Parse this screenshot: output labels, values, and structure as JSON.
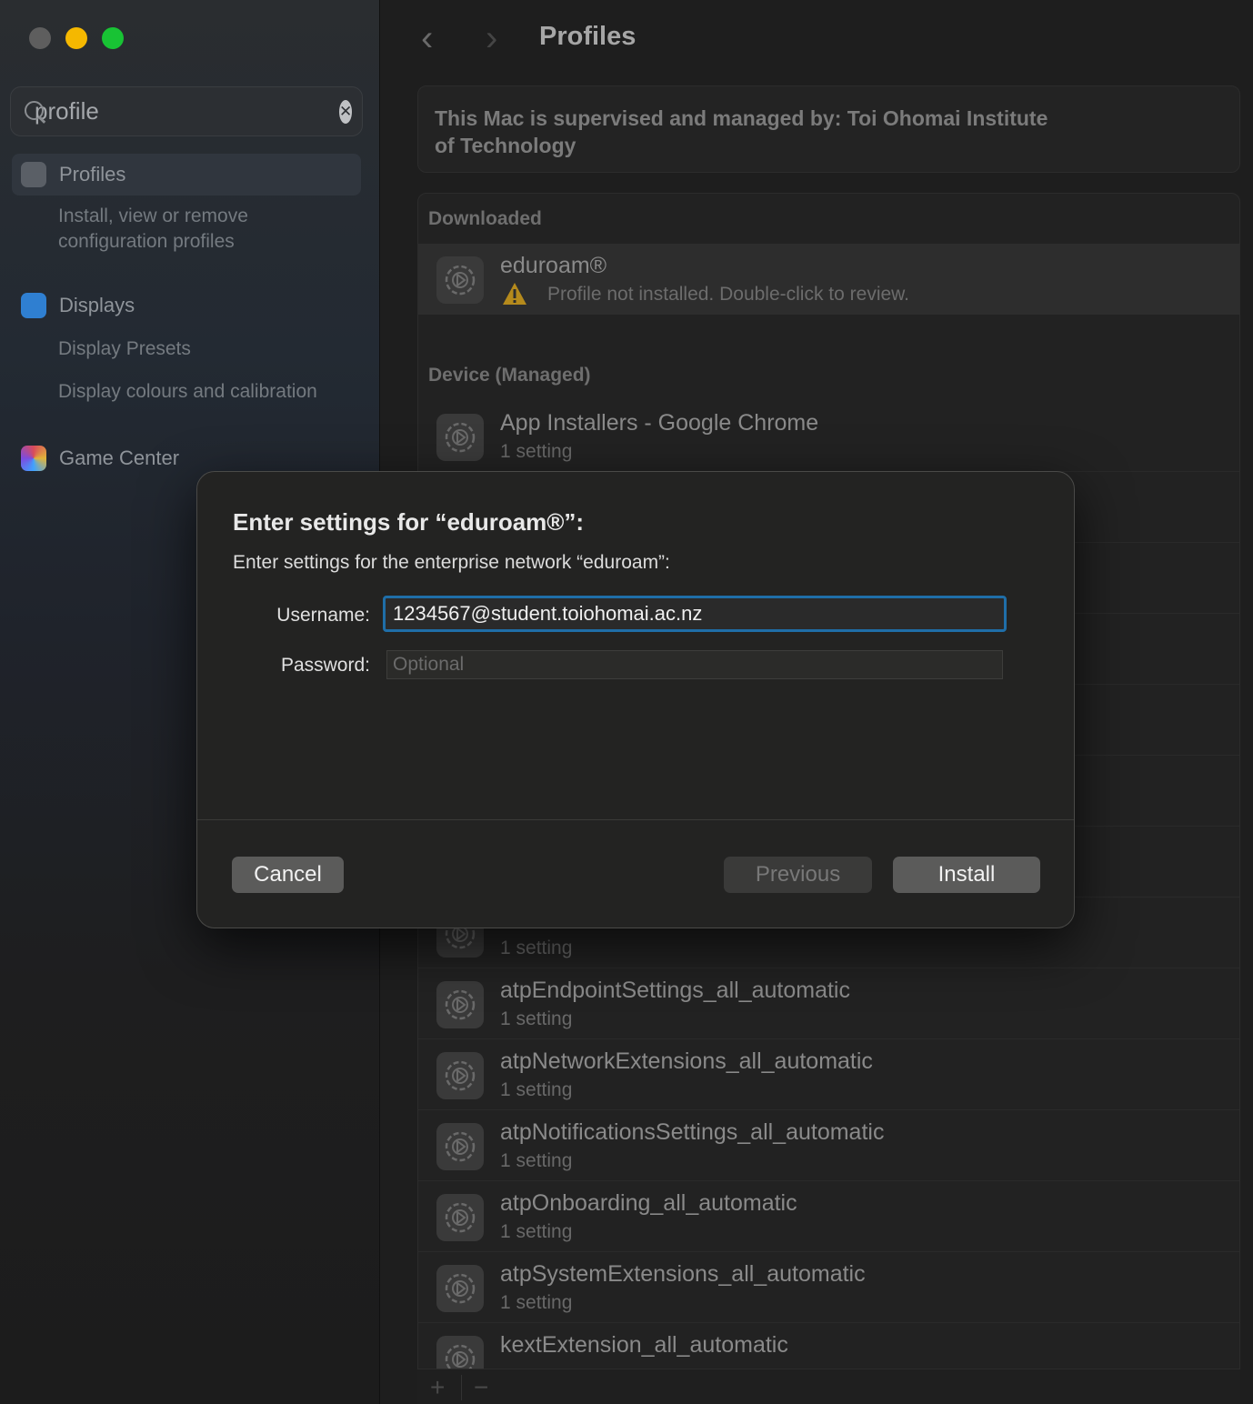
{
  "sidebar": {
    "search": {
      "value": "profile"
    },
    "items": [
      {
        "label": "Profiles",
        "sub": [
          "Install, view or remove configuration profiles"
        ]
      },
      {
        "label": "Displays",
        "sub": [
          "Display Presets",
          "Display colours and calibration"
        ]
      },
      {
        "label": "Game Center",
        "sub": []
      }
    ]
  },
  "main": {
    "title": "Profiles",
    "supervised_line1": "This Mac is supervised and managed by: Toi Ohomai Institute",
    "supervised_line2": "of Technology",
    "sections": {
      "downloaded": "Downloaded",
      "device": "Device (Managed)"
    },
    "downloaded_items": [
      {
        "title": "eduroam®",
        "status": "Profile not installed. Double-click to review."
      }
    ],
    "device_items": [
      {
        "title": "App Installers - Google Chrome",
        "sub": "1 setting"
      },
      {
        "title": "",
        "sub": "1 setting"
      },
      {
        "title": "atpEndpointSettings_all_automatic",
        "sub": "1 setting"
      },
      {
        "title": "atpNetworkExtensions_all_automatic",
        "sub": "1 setting"
      },
      {
        "title": "atpNotificationsSettings_all_automatic",
        "sub": "1 setting"
      },
      {
        "title": "atpOnboarding_all_automatic",
        "sub": "1 setting"
      },
      {
        "title": "atpSystemExtensions_all_automatic",
        "sub": "1 setting"
      },
      {
        "title": "kextExtension_all_automatic",
        "sub": ""
      }
    ],
    "footer": {
      "add": "+",
      "remove": "−"
    }
  },
  "dialog": {
    "title": "Enter settings for “eduroam®”:",
    "subtitle": "Enter settings for the enterprise network “eduroam”:",
    "username_label": "Username:",
    "username_value": "1234567@student.toiohomai.ac.nz",
    "password_label": "Password:",
    "password_placeholder": "Optional",
    "cancel": "Cancel",
    "previous": "Previous",
    "install": "Install"
  },
  "colors": {
    "accent_focus": "#1f6ea8",
    "traffic_close": "#5e5e5e",
    "traffic_minimize": "#f5b800",
    "traffic_maximize": "#18c334",
    "warning": "#d9a520"
  }
}
